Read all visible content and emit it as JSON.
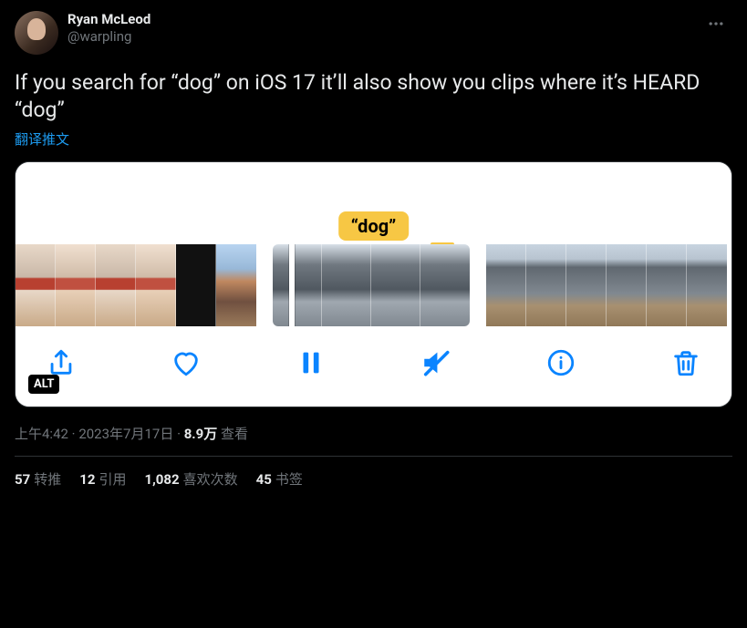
{
  "author": {
    "display_name": "Ryan McLeod",
    "handle": "@warpling"
  },
  "body_text": "If you search for “dog” on iOS 17 it’ll also show you clips where it’s HEARD “dog”",
  "translate_label": "翻译推文",
  "media": {
    "badge_text": "“dog”",
    "alt_label": "ALT"
  },
  "meta": {
    "time": "上午4:42",
    "date": "2023年7月17日",
    "views_strong": "8.9万",
    "views_label": "查看"
  },
  "stats": {
    "retweets_num": "57",
    "retweets_label": "转推",
    "quotes_num": "12",
    "quotes_label": "引用",
    "likes_num": "1,082",
    "likes_label": "喜欢次数",
    "bookmarks_num": "45",
    "bookmarks_label": "书签"
  }
}
